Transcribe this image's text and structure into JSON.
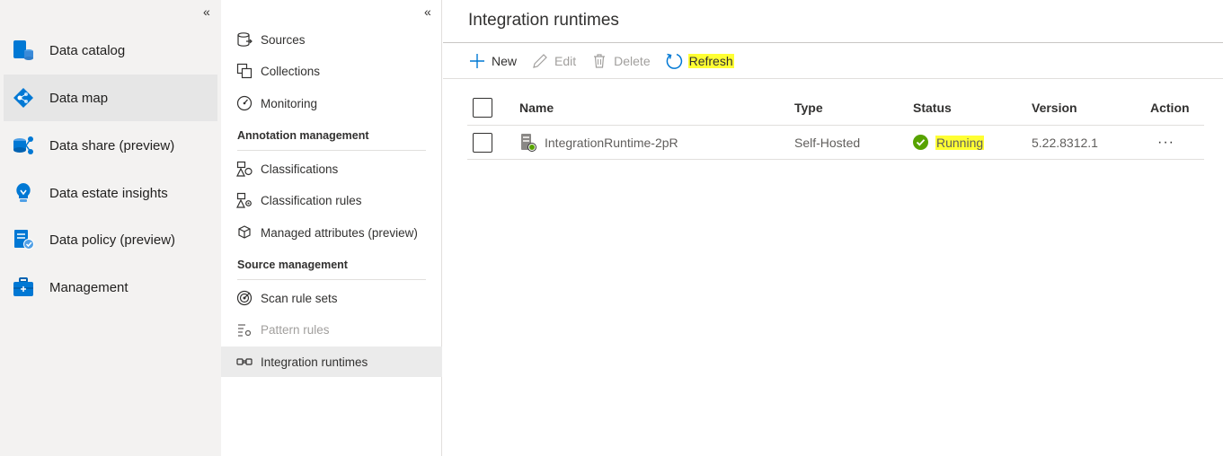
{
  "left_nav": {
    "collapse_glyph": "«",
    "items": [
      {
        "label": "Data catalog",
        "icon": "data-catalog-icon"
      },
      {
        "label": "Data map",
        "icon": "data-map-icon",
        "selected": true
      },
      {
        "label": "Data share (preview)",
        "icon": "data-share-icon"
      },
      {
        "label": "Data estate insights",
        "icon": "insights-icon"
      },
      {
        "label": "Data policy (preview)",
        "icon": "data-policy-icon"
      },
      {
        "label": "Management",
        "icon": "management-icon"
      }
    ]
  },
  "sub_nav": {
    "collapse_glyph": "«",
    "items": [
      {
        "label": "Sources",
        "icon": "sources-icon"
      },
      {
        "label": "Collections",
        "icon": "collections-icon"
      },
      {
        "label": "Monitoring",
        "icon": "monitoring-icon"
      }
    ],
    "annotation_header": "Annotation management",
    "annotation_items": [
      {
        "label": "Classifications",
        "icon": "classifications-icon"
      },
      {
        "label": "Classification rules",
        "icon": "classification-rules-icon"
      },
      {
        "label": "Managed attributes (preview)",
        "icon": "managed-attributes-icon"
      }
    ],
    "source_header": "Source management",
    "source_items": [
      {
        "label": "Scan rule sets",
        "icon": "scan-rule-sets-icon"
      },
      {
        "label": "Pattern rules",
        "icon": "pattern-rules-icon",
        "disabled": true
      },
      {
        "label": "Integration runtimes",
        "icon": "integration-runtimes-icon",
        "selected": true
      }
    ]
  },
  "main": {
    "title": "Integration runtimes",
    "toolbar": {
      "new_label": "New",
      "edit_label": "Edit",
      "delete_label": "Delete",
      "refresh_label": "Refresh"
    },
    "table": {
      "headers": {
        "name": "Name",
        "type": "Type",
        "status": "Status",
        "version": "Version",
        "action": "Action"
      },
      "rows": [
        {
          "name": "IntegrationRuntime-2pR",
          "type": "Self-Hosted",
          "status": "Running",
          "version": "5.22.8312.1",
          "action": "···"
        }
      ]
    }
  },
  "colors": {
    "accent": "#0078d4",
    "status_running": "#57a300",
    "highlight": "#ffff33"
  }
}
